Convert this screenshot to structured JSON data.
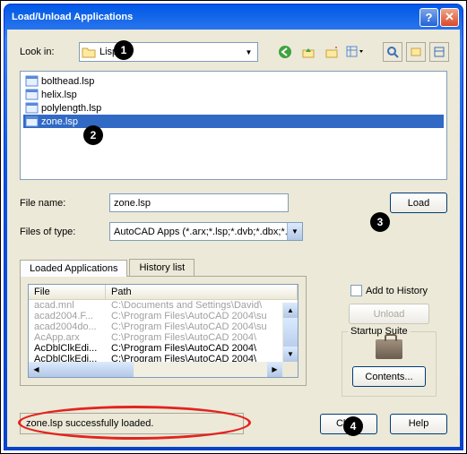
{
  "titlebar": {
    "title": "Load/Unload Applications"
  },
  "lookin": {
    "label": "Look in:",
    "folder": "Lisp"
  },
  "file_list": [
    {
      "name": "bolthead.lsp",
      "selected": false
    },
    {
      "name": "helix.lsp",
      "selected": false
    },
    {
      "name": "polylength.lsp",
      "selected": false
    },
    {
      "name": "zone.lsp",
      "selected": true
    }
  ],
  "filename": {
    "label": "File name:",
    "value": "zone.lsp"
  },
  "filetype": {
    "label": "Files of type:",
    "value": "AutoCAD Apps (*.arx;*.lsp;*.dvb;*.dbx;*.vlx;*."
  },
  "load_btn": "Load",
  "tabs": {
    "loaded": "Loaded Applications",
    "history": "History list"
  },
  "listview": {
    "cols": {
      "file": "File",
      "path": "Path"
    },
    "rows": [
      {
        "file": "acad.mnl",
        "path": "C:\\Documents and Settings\\David\\",
        "gray": true
      },
      {
        "file": "acad2004.F...",
        "path": "C:\\Program Files\\AutoCAD 2004\\su",
        "gray": true
      },
      {
        "file": "acad2004do...",
        "path": "C:\\Program Files\\AutoCAD 2004\\su",
        "gray": true
      },
      {
        "file": "AcApp.arx",
        "path": "C:\\Program Files\\AutoCAD 2004\\",
        "gray": true
      },
      {
        "file": "AcDblClkEdi...",
        "path": "C:\\Program Files\\AutoCAD 2004\\",
        "gray": false
      },
      {
        "file": "AcDblClkEdi...",
        "path": "C:\\Program Files\\AutoCAD 2004\\",
        "gray": false
      }
    ]
  },
  "add_history": "Add to History",
  "unload_btn": "Unload",
  "startup": {
    "title": "Startup Suite",
    "contents": "Contents..."
  },
  "status": "zone.lsp successfully loaded.",
  "close_btn": "Close",
  "help_btn": "Help",
  "callouts": {
    "one": "1",
    "two": "2",
    "three": "3",
    "four": "4"
  }
}
